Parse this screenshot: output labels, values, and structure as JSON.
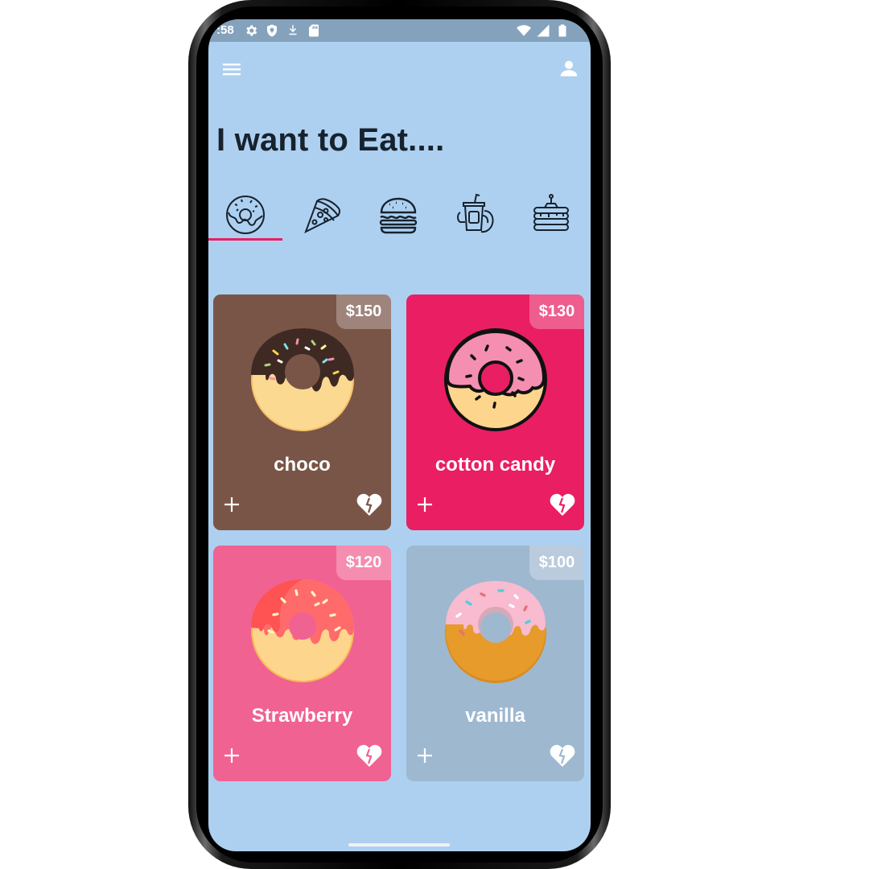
{
  "status_bar": {
    "time": ":58",
    "icons_left": [
      "settings-icon",
      "shield-icon",
      "download-icon",
      "sd-card-icon"
    ],
    "icons_right": [
      "wifi-icon",
      "signal-icon",
      "battery-icon"
    ]
  },
  "app_bar": {
    "menu_icon": "hamburger-menu-icon",
    "profile_icon": "person-icon"
  },
  "title": "I want to Eat....",
  "categories": [
    {
      "icon": "donut-icon",
      "selected": true
    },
    {
      "icon": "pizza-icon",
      "selected": false
    },
    {
      "icon": "burger-icon",
      "selected": false
    },
    {
      "icon": "smoothie-icon",
      "selected": false
    },
    {
      "icon": "pancake-icon",
      "selected": false
    }
  ],
  "accent_color": "#e91e63",
  "products": [
    {
      "name": "choco",
      "price": "$150",
      "bg_color": "#795548",
      "icon": "chocolate-donut-icon"
    },
    {
      "name": "cotton candy",
      "price": "$130",
      "bg_color": "#e91e63",
      "icon": "pink-donut-icon"
    },
    {
      "name": "Strawberry",
      "price": "$120",
      "bg_color": "#f06292",
      "icon": "strawberry-donut-icon"
    },
    {
      "name": "vanilla",
      "price": "$100",
      "bg_color": "#9eb8d0",
      "icon": "vanilla-donut-icon"
    }
  ]
}
